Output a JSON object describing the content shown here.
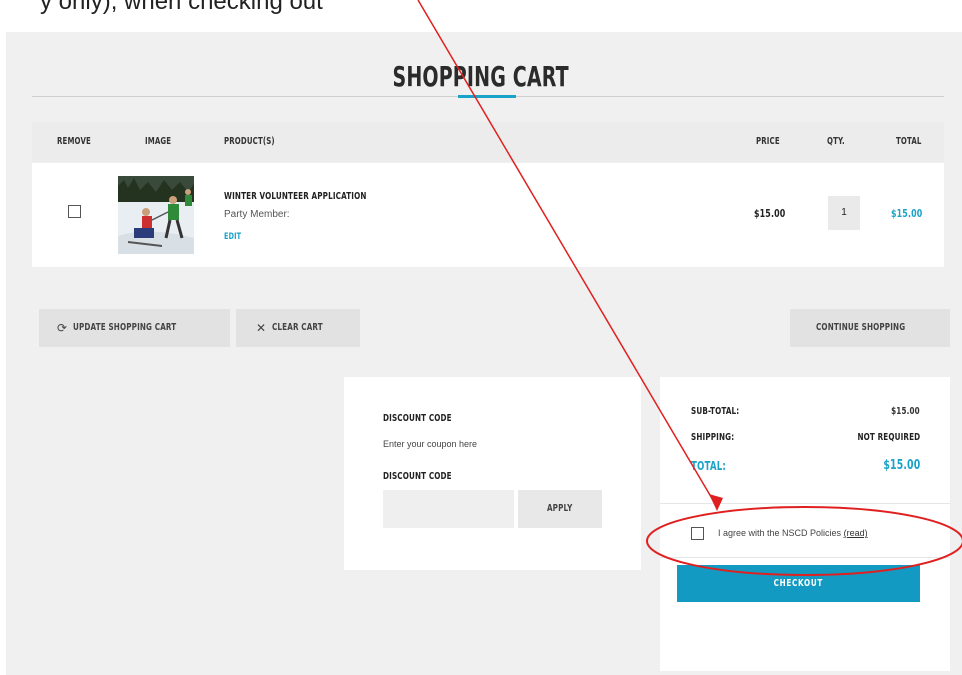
{
  "page": {
    "top_caption": "y only), when checking out"
  },
  "cart": {
    "title": "SHOPPING CART",
    "columns": {
      "remove": "REMOVE",
      "image": "IMAGE",
      "products": "PRODUCT(S)",
      "price": "PRICE",
      "qty": "QTY.",
      "total": "TOTAL"
    },
    "item": {
      "name": "WINTER VOLUNTEER APPLICATION",
      "subtitle": "Party Member:",
      "edit_label": "EDIT",
      "price": "$15.00",
      "qty": "1",
      "total": "$15.00"
    },
    "update_label": "UPDATE SHOPPING CART",
    "clear_label": "CLEAR CART",
    "continue_label": "CONTINUE SHOPPING"
  },
  "discount": {
    "heading": "DISCOUNT CODE",
    "help_text": "Enter your coupon here",
    "field_label": "DISCOUNT CODE",
    "input_value": "",
    "apply_label": "APPLY"
  },
  "summary": {
    "subtotal_label": "SUB-TOTAL:",
    "subtotal_value": "$15.00",
    "shipping_label": "SHIPPING:",
    "shipping_value": "NOT REQUIRED",
    "total_label": "TOTAL:",
    "total_value": "$15.00",
    "agree_text": "I agree with the NSCD Policies",
    "agree_link": "(read)",
    "checkout_label": "CHECKOUT"
  },
  "colors": {
    "accent": "#1aa3c8",
    "checkout": "#139ac2",
    "annotation": "#e02020"
  },
  "icons": {
    "update": "refresh-icon",
    "clear": "close-icon"
  }
}
